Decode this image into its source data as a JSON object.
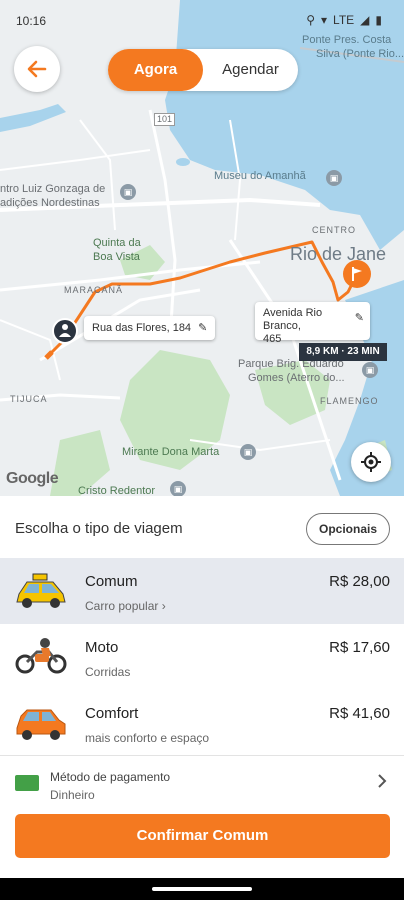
{
  "status_bar": {
    "time": "10:16",
    "network": "LTE"
  },
  "mode_toggle": {
    "active": "Agora",
    "inactive": "Agendar"
  },
  "map": {
    "labels": {
      "ponte": "Ponte Pres. Costa",
      "ponte2": "Silva (Ponte Rio...",
      "museu": "Museu do Amanhã",
      "centro_luiz": "ntro Luiz Gonzaga de",
      "tradicoes": "adições Nordestinas",
      "quinta": "Quinta da",
      "boa_vista": "Boa Vista",
      "maracana": "MARACANÃ",
      "centro": "CENTRO",
      "rio": "Rio de Jane",
      "parque": "Parque Brig. Eduardo",
      "parque2": "Gomes (Aterro do...",
      "tijuca": "TIJUCA",
      "flamengo": "FLAMENGO",
      "mirante": "Mirante Dona Marta",
      "cristo": "Cristo Redentor",
      "road": "101"
    },
    "origin_bubble": "Rua das Flores, 184",
    "dest_bubble_line1": "Avenida Rio Branco,",
    "dest_bubble_line2": "465",
    "eta": "8,9 KM · 23 MIN",
    "google_logo": "Google"
  },
  "sheet": {
    "title": "Escolha o tipo de viagem",
    "options_button": "Opcionais",
    "rides": [
      {
        "name": "Comum",
        "sub": "Carro popular ›",
        "price": "R$ 28,00",
        "icon": "taxi-icon"
      },
      {
        "name": "Moto",
        "sub": "Corridas",
        "price": "R$ 17,60",
        "icon": "motorcycle-icon"
      },
      {
        "name": "Comfort",
        "sub": "mais conforto e espaço",
        "price": "R$ 41,60",
        "icon": "comfort-car-icon"
      }
    ],
    "payment": {
      "label": "Método de pagamento",
      "value": "Dinheiro"
    },
    "confirm": "Confirmar Comum"
  },
  "colors": {
    "accent": "#f47920",
    "water": "#a8d3ec",
    "route": "#f47920"
  }
}
